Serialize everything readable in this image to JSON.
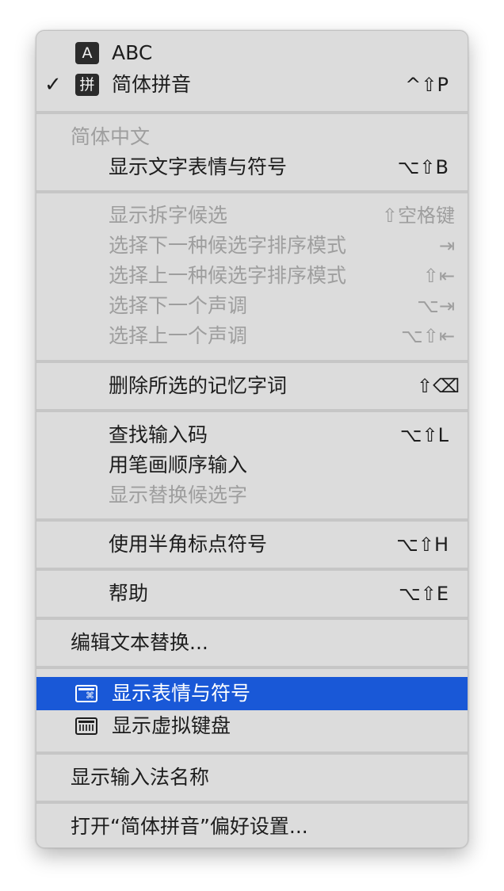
{
  "menu": {
    "input_sources": [
      {
        "badge": "A",
        "label": "ABC",
        "checked": false
      },
      {
        "badge": "拼",
        "label": "简体拼音",
        "checked": true,
        "check_mark": "✓",
        "shortcut": "^⇧P"
      }
    ],
    "section_header": "简体中文",
    "show_emoji_text": {
      "label": "显示文字表情与符号",
      "shortcut": "⌥⇧B"
    },
    "candidate_items": [
      {
        "label": "显示拆字候选",
        "shortcut": "⇧空格键"
      },
      {
        "label": "选择下一种候选字排序模式",
        "shortcut": "⇥"
      },
      {
        "label": "选择上一种候选字排序模式",
        "shortcut": "⇧⇤"
      },
      {
        "label": "选择下一个声调",
        "shortcut": "⌥⇥"
      },
      {
        "label": "选择上一个声调",
        "shortcut": "⌥⇧⇤"
      }
    ],
    "delete_memory": {
      "label": "删除所选的记忆字词",
      "shortcut": "⇧⌫"
    },
    "lookup_items": [
      {
        "label": "查找输入码",
        "shortcut": "⌥⇧L"
      },
      {
        "label": "用笔画顺序输入",
        "shortcut": ""
      },
      {
        "label": "显示替换候选字",
        "shortcut": ""
      }
    ],
    "halfwidth_punct": {
      "label": "使用半角标点符号",
      "shortcut": "⌥⇧H"
    },
    "help": {
      "label": "帮助",
      "shortcut": "⌥⇧E"
    },
    "edit_text_replacement": {
      "label": "编辑文本替换..."
    },
    "show_emoji_symbols": {
      "label": "显示表情与符号",
      "icon": "emoji-viewer-icon",
      "icon_glyph": "⌘"
    },
    "show_virtual_keyboard": {
      "label": "显示虚拟键盘",
      "icon": "keyboard-viewer-icon"
    },
    "show_input_name": {
      "label": "显示输入法名称"
    },
    "open_preferences": {
      "label": "打开“简体拼音”偏好设置..."
    }
  },
  "colors": {
    "menu_background": "#dcdcdc",
    "selected_highlight": "#1958d7",
    "disabled_text": "#9e9e9e",
    "separator": "#c6c6c6"
  }
}
